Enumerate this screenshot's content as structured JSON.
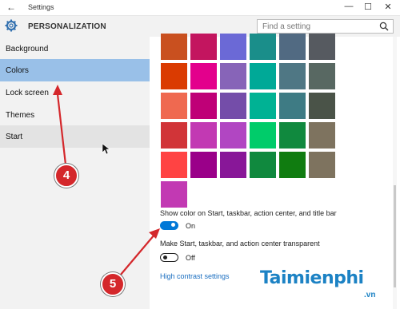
{
  "window": {
    "title": "Settings",
    "minimize": "—",
    "maximize": "☐",
    "close": "✕",
    "back": "←"
  },
  "header": {
    "title": "PERSONALIZATION"
  },
  "search": {
    "placeholder": "Find a setting"
  },
  "sidebar": {
    "items": [
      {
        "label": "Background"
      },
      {
        "label": "Colors"
      },
      {
        "label": "Lock screen"
      },
      {
        "label": "Themes"
      },
      {
        "label": "Start"
      }
    ],
    "selected": "Colors"
  },
  "colors": {
    "swatches": [
      [
        "#c9501f",
        "#c3155f",
        "#6b69d6",
        "#1a8e8a",
        "#516a82",
        "#565a60"
      ],
      [
        "#da3b01",
        "#e3008c",
        "#8764b8",
        "#00a997",
        "#4f7784",
        "#586862"
      ],
      [
        "#ef6950",
        "#bf0077",
        "#744da9",
        "#00b294",
        "#3e7b84",
        "#4a5348"
      ],
      [
        "#d13438",
        "#c239b3",
        "#b146c2",
        "#00cc6a",
        "#10893e",
        "#7e735f"
      ],
      [
        "#ff4343",
        "#9a0089",
        "#881798",
        "#10893e",
        "#107c10",
        "#7e735f"
      ],
      [
        "#c239b3"
      ]
    ]
  },
  "options": {
    "show_color": {
      "label": "Show color on Start, taskbar, action center, and title bar",
      "state": "On",
      "on": true
    },
    "transparent": {
      "label": "Make Start, taskbar, and action center transparent",
      "state": "Off",
      "on": false
    },
    "high_contrast_link": "High contrast settings"
  },
  "annotations": [
    {
      "number": "4"
    },
    {
      "number": "5"
    }
  ],
  "watermark": {
    "text": "Taimienphi",
    "suffix": ".vn"
  },
  "accent_color": "#0078d7"
}
